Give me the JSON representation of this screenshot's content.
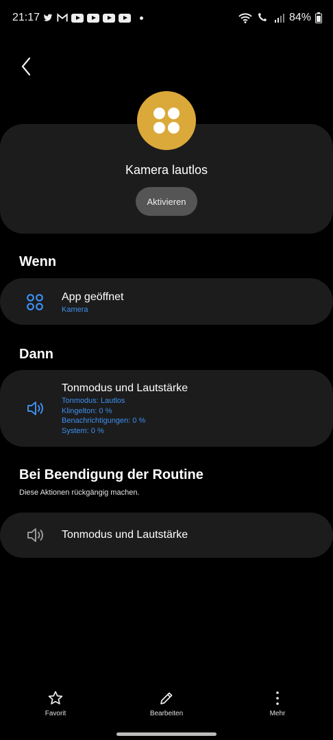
{
  "status_bar": {
    "time": "21:17",
    "battery": "84%",
    "notification_icons": [
      "twitter-icon",
      "gmail-icon",
      "youtube-icon",
      "youtube-icon",
      "youtube-icon",
      "youtube-icon"
    ]
  },
  "routine": {
    "title": "Kamera lautlos",
    "activate_label": "Aktivieren",
    "badge_color": "#dba93a"
  },
  "when": {
    "title": "Wenn",
    "condition_title": "App geöffnet",
    "condition_detail": "Kamera"
  },
  "then": {
    "title": "Dann",
    "action_title": "Tonmodus und Lautstärke",
    "details": [
      "Tonmodus: Lautlos",
      "Klingelton: 0 %",
      "Benachrichtigungen: 0 %",
      "System: 0 %"
    ]
  },
  "on_end": {
    "title": "Bei Beendigung der Routine",
    "subtitle": "Diese Aktionen rückgängig machen.",
    "action_title": "Tonmodus und Lautstärke"
  },
  "bottom_nav": {
    "favorite": "Favorit",
    "edit": "Bearbeiten",
    "more": "Mehr"
  },
  "colors": {
    "accent": "#3e8ff0",
    "card": "#1c1c1c",
    "background": "#000000"
  }
}
